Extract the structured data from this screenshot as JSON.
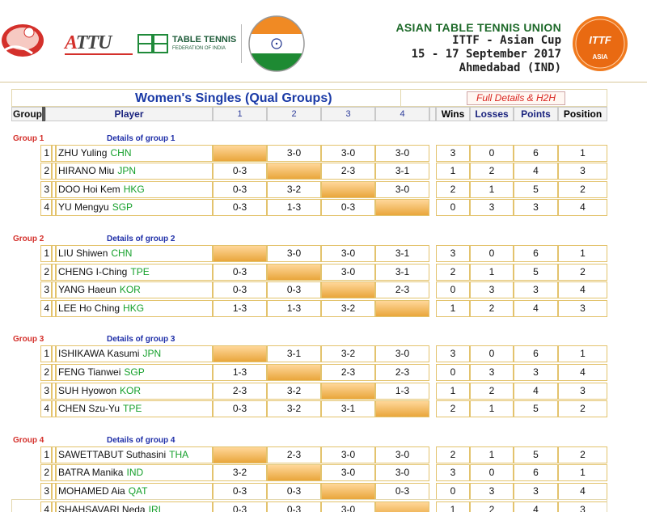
{
  "header": {
    "union": "ASIAN TABLE TENNIS UNION",
    "event": "ITTF - Asian Cup",
    "dates": "15 - 17 September 2017",
    "city": "Ahmedabad (IND)",
    "attu_logo": "ATTU",
    "tt_federation_title": "TABLE TENNIS",
    "tt_federation_sub": "FEDERATION OF INDIA",
    "badge_text": "ITTF",
    "badge_sub": "ASIA"
  },
  "page_title": "Women's Singles (Qual Groups)",
  "h2h_button": "Full Details & H2H",
  "columns": {
    "group": "Group",
    "player": "Player",
    "c1": "1",
    "c2": "2",
    "c3": "3",
    "c4": "4",
    "wins": "Wins",
    "losses": "Losses",
    "points": "Points",
    "position": "Position"
  },
  "groups": [
    {
      "label": "Group 1",
      "link": "Details of group 1",
      "rows": [
        {
          "seed": "1",
          "name": "ZHU Yuling",
          "nat": "CHN",
          "s": [
            "",
            "3-0",
            "3-0",
            "3-0"
          ],
          "wins": "3",
          "losses": "0",
          "points": "6",
          "position": "1"
        },
        {
          "seed": "2",
          "name": "HIRANO Miu",
          "nat": "JPN",
          "s": [
            "0-3",
            "",
            "2-3",
            "3-1"
          ],
          "wins": "1",
          "losses": "2",
          "points": "4",
          "position": "3"
        },
        {
          "seed": "3",
          "name": "DOO Hoi Kem",
          "nat": "HKG",
          "s": [
            "0-3",
            "3-2",
            "",
            "3-0"
          ],
          "wins": "2",
          "losses": "1",
          "points": "5",
          "position": "2"
        },
        {
          "seed": "4",
          "name": "YU Mengyu",
          "nat": "SGP",
          "s": [
            "0-3",
            "1-3",
            "0-3",
            ""
          ],
          "wins": "0",
          "losses": "3",
          "points": "3",
          "position": "4"
        }
      ]
    },
    {
      "label": "Group 2",
      "link": "Details of group 2",
      "rows": [
        {
          "seed": "1",
          "name": "LIU Shiwen",
          "nat": "CHN",
          "s": [
            "",
            "3-0",
            "3-0",
            "3-1"
          ],
          "wins": "3",
          "losses": "0",
          "points": "6",
          "position": "1"
        },
        {
          "seed": "2",
          "name": "CHENG I-Ching",
          "nat": "TPE",
          "s": [
            "0-3",
            "",
            "3-0",
            "3-1"
          ],
          "wins": "2",
          "losses": "1",
          "points": "5",
          "position": "2"
        },
        {
          "seed": "3",
          "name": "YANG Haeun",
          "nat": "KOR",
          "s": [
            "0-3",
            "0-3",
            "",
            "2-3"
          ],
          "wins": "0",
          "losses": "3",
          "points": "3",
          "position": "4"
        },
        {
          "seed": "4",
          "name": "LEE Ho Ching",
          "nat": "HKG",
          "s": [
            "1-3",
            "1-3",
            "3-2",
            ""
          ],
          "wins": "1",
          "losses": "2",
          "points": "4",
          "position": "3"
        }
      ]
    },
    {
      "label": "Group 3",
      "link": "Details of group 3",
      "rows": [
        {
          "seed": "1",
          "name": "ISHIKAWA Kasumi",
          "nat": "JPN",
          "s": [
            "",
            "3-1",
            "3-2",
            "3-0"
          ],
          "wins": "3",
          "losses": "0",
          "points": "6",
          "position": "1"
        },
        {
          "seed": "2",
          "name": "FENG Tianwei",
          "nat": "SGP",
          "s": [
            "1-3",
            "",
            "2-3",
            "2-3"
          ],
          "wins": "0",
          "losses": "3",
          "points": "3",
          "position": "4"
        },
        {
          "seed": "3",
          "name": "SUH Hyowon",
          "nat": "KOR",
          "s": [
            "2-3",
            "3-2",
            "",
            "1-3"
          ],
          "wins": "1",
          "losses": "2",
          "points": "4",
          "position": "3"
        },
        {
          "seed": "4",
          "name": "CHEN Szu-Yu",
          "nat": "TPE",
          "s": [
            "0-3",
            "3-2",
            "3-1",
            ""
          ],
          "wins": "2",
          "losses": "1",
          "points": "5",
          "position": "2"
        }
      ]
    },
    {
      "label": "Group 4",
      "link": "Details of group 4",
      "rows": [
        {
          "seed": "1",
          "name": "SAWETTABUT Suthasini",
          "nat": "THA",
          "s": [
            "",
            "2-3",
            "3-0",
            "3-0"
          ],
          "wins": "2",
          "losses": "1",
          "points": "5",
          "position": "2"
        },
        {
          "seed": "2",
          "name": "BATRA Manika",
          "nat": "IND",
          "s": [
            "3-2",
            "",
            "3-0",
            "3-0"
          ],
          "wins": "3",
          "losses": "0",
          "points": "6",
          "position": "1"
        },
        {
          "seed": "3",
          "name": "MOHAMED Aia",
          "nat": "QAT",
          "s": [
            "0-3",
            "0-3",
            "",
            "0-3"
          ],
          "wins": "0",
          "losses": "3",
          "points": "3",
          "position": "4"
        },
        {
          "seed": "4",
          "name": "SHAHSAVARI Neda",
          "nat": "IRI",
          "s": [
            "0-3",
            "0-3",
            "3-0",
            ""
          ],
          "wins": "1",
          "losses": "2",
          "points": "4",
          "position": "3"
        }
      ]
    }
  ],
  "colors": {
    "title_blue": "#1a3aa6",
    "group_red": "#d4302b",
    "nation_green": "#15a02b",
    "cell_border": "#e3c36d",
    "self_cell": "#e9a63c"
  }
}
